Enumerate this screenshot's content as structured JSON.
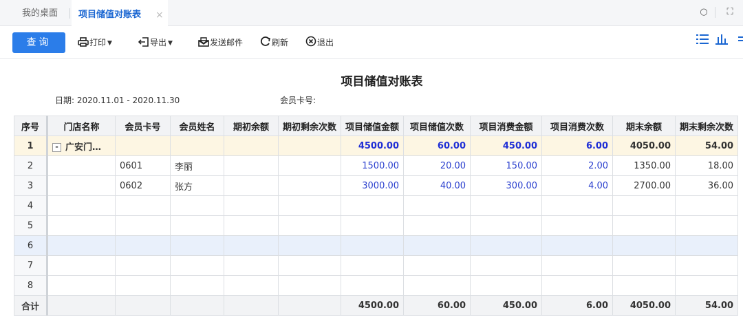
{
  "tabs": {
    "home": "我的桌面",
    "active": "项目储值对账表",
    "close_glyph": "×"
  },
  "window_icons": {
    "search": "○",
    "fullscreen": "⛶"
  },
  "toolbar": {
    "query": "查询",
    "print": "打印",
    "export": "导出",
    "email": "发送邮件",
    "refresh": "刷新",
    "exit": "退出"
  },
  "report": {
    "title": "项目储值对账表",
    "date_label": "日期:",
    "date_value": "2020.11.01 - 2020.11.30",
    "card_label": "会员卡号:"
  },
  "table": {
    "headers": [
      "序号",
      "门店名称",
      "会员卡号",
      "会员姓名",
      "期初余额",
      "期初剩余次数",
      "项目储值金额",
      "项目储值次数",
      "项目消费金额",
      "项目消费次数",
      "期末余额",
      "期末剩余次数"
    ],
    "rows": [
      {
        "idx": "1",
        "store": "广安门…",
        "card": "",
        "name": "",
        "open_bal": "",
        "open_cnt": "",
        "dep_amt": "4500.00",
        "dep_cnt": "60.00",
        "use_amt": "450.00",
        "use_cnt": "6.00",
        "end_bal": "4050.00",
        "end_cnt": "54.00"
      },
      {
        "idx": "2",
        "store": "",
        "card": "0601",
        "name": "李丽",
        "open_bal": "",
        "open_cnt": "",
        "dep_amt": "1500.00",
        "dep_cnt": "20.00",
        "use_amt": "150.00",
        "use_cnt": "2.00",
        "end_bal": "1350.00",
        "end_cnt": "18.00"
      },
      {
        "idx": "3",
        "store": "",
        "card": "0602",
        "name": "张方",
        "open_bal": "",
        "open_cnt": "",
        "dep_amt": "3000.00",
        "dep_cnt": "40.00",
        "use_amt": "300.00",
        "use_cnt": "4.00",
        "end_bal": "2700.00",
        "end_cnt": "36.00"
      },
      {
        "idx": "4"
      },
      {
        "idx": "5"
      },
      {
        "idx": "6"
      },
      {
        "idx": "7"
      },
      {
        "idx": "8"
      }
    ],
    "total": {
      "label": "合计",
      "dep_amt": "4500.00",
      "dep_cnt": "60.00",
      "use_amt": "450.00",
      "use_cnt": "6.00",
      "end_bal": "4050.00",
      "end_cnt": "54.00"
    },
    "expander_glyph": "-"
  },
  "colors": {
    "accent": "#2b7de9",
    "value_blue": "#1f2fd6",
    "group_row": "#fdf6e3",
    "selected_row": "#e9f0fb"
  }
}
